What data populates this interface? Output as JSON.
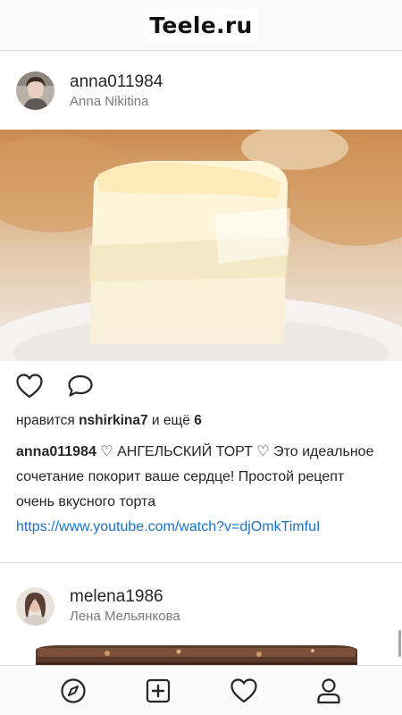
{
  "app": {
    "logo_text": "Teele.ru"
  },
  "posts": [
    {
      "username": "anna011984",
      "full_name": "Anna Nikitina",
      "likes": {
        "prefix": "нравится",
        "user": "nshirkina7",
        "middle": "и ещё",
        "count": "6"
      },
      "caption": {
        "author": "anna011984",
        "text": "♡ АНГЕЛЬСКИЙ ТОРТ ♡ Это идеальное сочетание покорит ваше сердце! Простой рецепт очень вкусного торта",
        "link": "https://www.youtube.com/watch?v=djOmkTimfuI"
      }
    },
    {
      "username": "melena1986",
      "full_name": "Лена Мельянкова"
    }
  ],
  "icons": {
    "like": "heart-icon",
    "comment": "comment-icon",
    "explore": "compass-icon",
    "add": "plus-square-icon",
    "activity": "heart-outline-icon",
    "profile": "person-icon"
  }
}
